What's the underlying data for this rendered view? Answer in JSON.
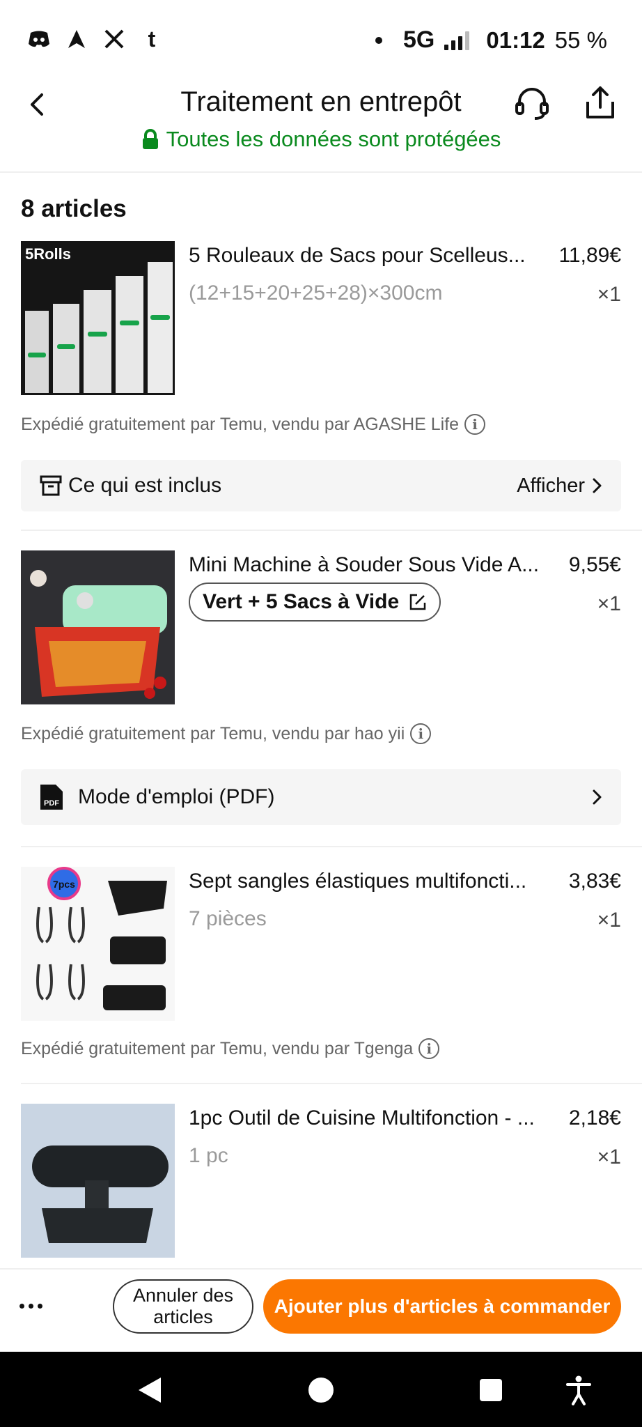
{
  "status_bar": {
    "network": "5G",
    "time": "01:12",
    "battery": "55 %",
    "left_icons": [
      "discord-icon",
      "navigation-arrow-icon",
      "x-logo-icon",
      "tumblr-icon"
    ]
  },
  "header": {
    "title": "Traitement en entrepôt",
    "secure_text": "Toutes les données sont protégées"
  },
  "colors": {
    "accent_orange": "#fb7701",
    "secure_green": "#0a8a1e"
  },
  "articles_count": "8 articles",
  "items": [
    {
      "title": "5 Rouleaux de Sacs pour Scelleus...",
      "price": "11,89€",
      "variant": "(12+15+20+25+28)×300cm",
      "qty": "×1",
      "shipping": "Expédié gratuitement par Temu, vendu par AGASHE Life",
      "thumb_label": "5Rolls"
    },
    {
      "title": "Mini Machine à Souder Sous Vide A...",
      "price": "9,55€",
      "variant": "Vert + 5 Sacs à Vide",
      "qty": "×1",
      "shipping": "Expédié gratuitement par Temu, vendu par hao yii"
    },
    {
      "title": "Sept sangles élastiques multifoncti...",
      "price": "3,83€",
      "variant": "7 pièces",
      "qty": "×1",
      "shipping": "Expédié gratuitement par Temu, vendu par Tgenga",
      "thumb_label": "7pcs"
    },
    {
      "title": "1pc Outil de Cuisine Multifonction - ...",
      "price": "2,18€",
      "variant": "1 pc",
      "qty": "×1"
    }
  ],
  "included_row": {
    "label": "Ce qui est inclus",
    "action": "Afficher"
  },
  "manual_row": {
    "label": "Mode d'emploi (PDF)",
    "pdf_badge": "PDF"
  },
  "bottom_bar": {
    "cancel_label_line1": "Annuler des",
    "cancel_label_line2": "articles",
    "add_label": "Ajouter plus d'articles à commander"
  }
}
